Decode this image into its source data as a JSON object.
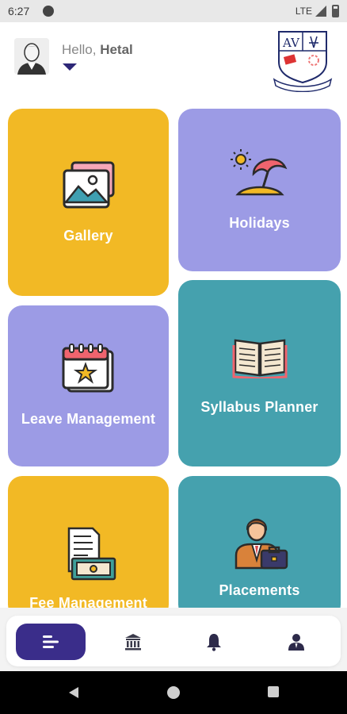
{
  "status_bar": {
    "time": "6:27",
    "network": "LTE"
  },
  "header": {
    "greeting": "Hello,",
    "user_name": "Hetal",
    "logo_text": "AV"
  },
  "tiles": [
    {
      "label": "Gallery",
      "icon": "gallery-icon",
      "color": "#f2b925"
    },
    {
      "label": "Holidays",
      "icon": "beach-umbrella-icon",
      "color": "#9c9be5"
    },
    {
      "label": "Leave Management",
      "icon": "calendar-star-icon",
      "color": "#9c9be5"
    },
    {
      "label": "Syllabus Planner",
      "icon": "open-book-icon",
      "color": "#45a1ae"
    },
    {
      "label": "Fee Management",
      "icon": "bill-money-icon",
      "color": "#f2b925"
    },
    {
      "label": "Placements",
      "icon": "businessman-icon",
      "color": "#45a1ae"
    }
  ],
  "bottom_nav": {
    "items": [
      {
        "icon": "menu-lines-icon",
        "active": true
      },
      {
        "icon": "institution-icon",
        "active": false
      },
      {
        "icon": "bell-icon",
        "active": false
      },
      {
        "icon": "profile-icon",
        "active": false
      }
    ],
    "accent": "#3a2d8a"
  },
  "system_nav": {
    "items": [
      "back-icon",
      "home-icon",
      "recents-icon"
    ]
  }
}
